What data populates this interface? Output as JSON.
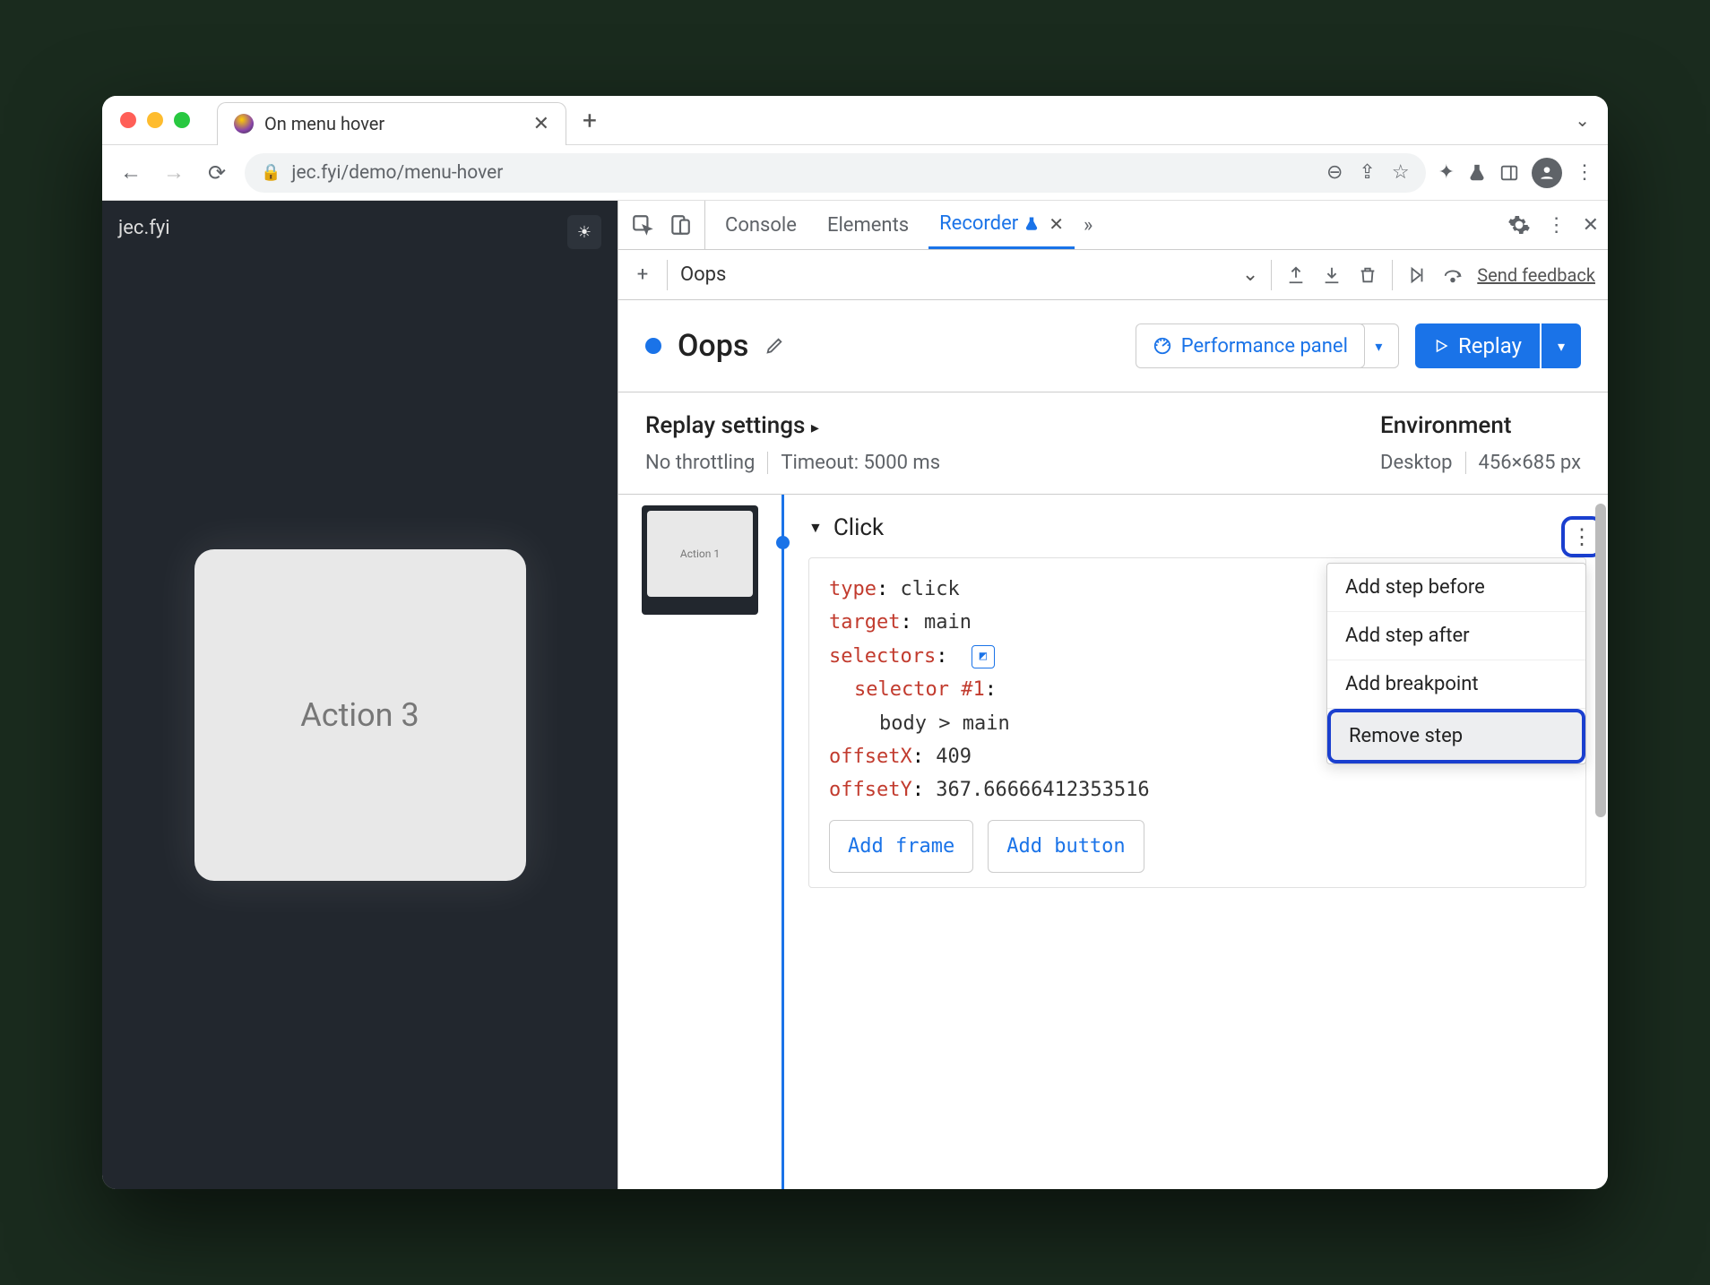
{
  "browser_tab": {
    "title": "On menu hover"
  },
  "url": "jec.fyi/demo/menu-hover",
  "page": {
    "site_title": "jec.fyi",
    "card_label": "Action 3",
    "thumb_label": "Action 1"
  },
  "devtools": {
    "tabs": {
      "console": "Console",
      "elements": "Elements",
      "recorder": "Recorder"
    },
    "sub_toolbar": {
      "recording_name": "Oops",
      "feedback": "Send feedback"
    },
    "header": {
      "title": "Oops",
      "perf_panel": "Performance panel",
      "replay": "Replay"
    },
    "settings": {
      "replay_title": "Replay settings",
      "throttle": "No throttling",
      "timeout": "Timeout: 5000 ms",
      "env_title": "Environment",
      "env_device": "Desktop",
      "env_dims": "456×685 px"
    },
    "step": {
      "title": "Click",
      "type_key": "type",
      "type_val": "click",
      "target_key": "target",
      "target_val": "main",
      "selectors_key": "selectors",
      "selector_label": "selector #1",
      "selector_val": "body > main",
      "offsetx_key": "offsetX",
      "offsetx_val": "409",
      "offsety_key": "offsetY",
      "offsety_val": "367.66666412353516",
      "add_frame": "Add frame",
      "add_button": "Add button"
    },
    "ctx": {
      "before": "Add step before",
      "after": "Add step after",
      "bp": "Add breakpoint",
      "remove": "Remove step"
    }
  }
}
